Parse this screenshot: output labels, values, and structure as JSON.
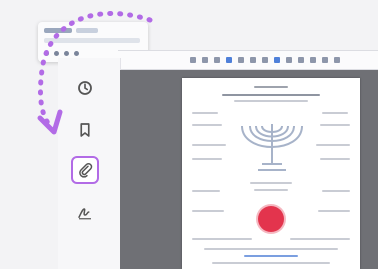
{
  "colors": {
    "accent": "#b26be6",
    "seal": "#e3344d",
    "viewer_bg": "#6f7075"
  },
  "sidebar": {
    "items": [
      {
        "icon": "clock-history-icon",
        "active": false
      },
      {
        "icon": "bookmark-icon",
        "active": false
      },
      {
        "icon": "attachment-icon",
        "active": true
      },
      {
        "icon": "signature-icon",
        "active": false
      }
    ]
  },
  "annotation": {
    "icon": "dotted-curved-arrow-icon"
  }
}
